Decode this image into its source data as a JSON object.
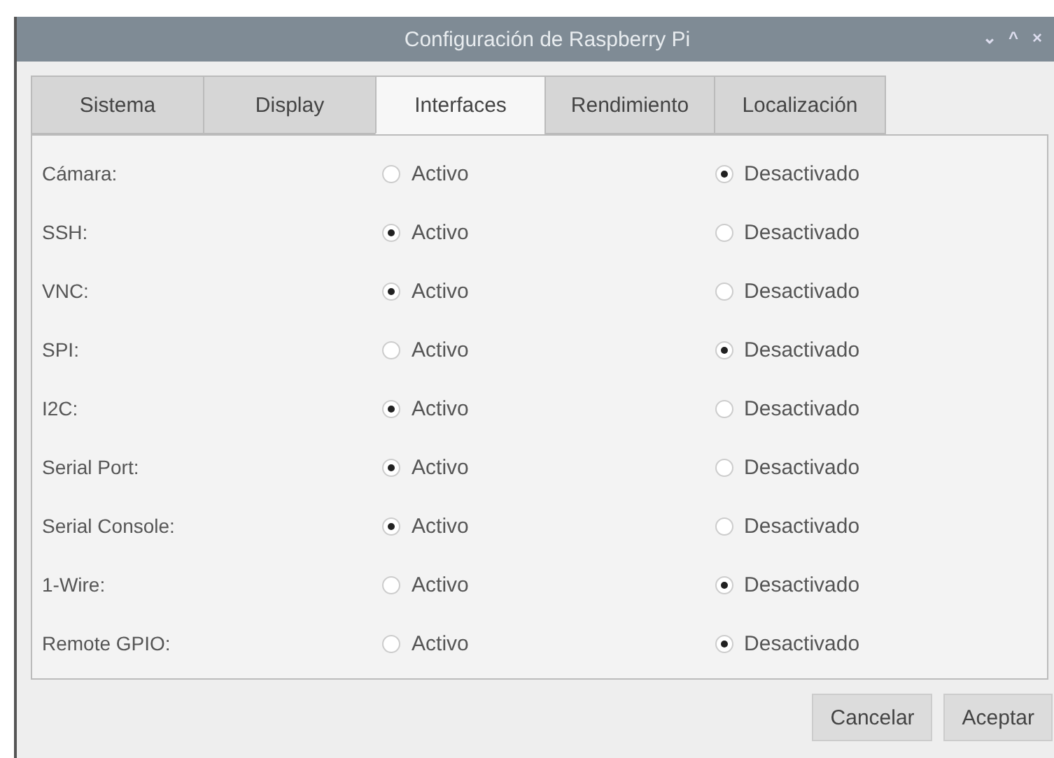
{
  "window": {
    "title": "Configuración de Raspberry Pi",
    "controls": [
      "⌄",
      "^",
      "×"
    ]
  },
  "tabs": [
    {
      "label": "Sistema",
      "selected": false
    },
    {
      "label": "Display",
      "selected": false
    },
    {
      "label": "Interfaces",
      "selected": true
    },
    {
      "label": "Rendimiento",
      "selected": false
    },
    {
      "label": "Localización",
      "selected": false
    }
  ],
  "settings": [
    {
      "label": "Cámara:",
      "options": [
        {
          "label": "Activo",
          "selected": false
        },
        {
          "label": "Desactivado",
          "selected": true
        }
      ]
    },
    {
      "label": "SSH:",
      "options": [
        {
          "label": "Activo",
          "selected": true
        },
        {
          "label": "Desactivado",
          "selected": false
        }
      ]
    },
    {
      "label": "VNC:",
      "options": [
        {
          "label": "Activo",
          "selected": true
        },
        {
          "label": "Desactivado",
          "selected": false
        }
      ]
    },
    {
      "label": "SPI:",
      "options": [
        {
          "label": "Activo",
          "selected": false
        },
        {
          "label": "Desactivado",
          "selected": true
        }
      ]
    },
    {
      "label": "I2C:",
      "options": [
        {
          "label": "Activo",
          "selected": true
        },
        {
          "label": "Desactivado",
          "selected": false
        }
      ]
    },
    {
      "label": "Serial Port:",
      "options": [
        {
          "label": "Activo",
          "selected": true
        },
        {
          "label": "Desactivado",
          "selected": false
        }
      ]
    },
    {
      "label": "Serial Console:",
      "options": [
        {
          "label": "Activo",
          "selected": true
        },
        {
          "label": "Desactivado",
          "selected": false
        }
      ]
    },
    {
      "label": "1-Wire:",
      "options": [
        {
          "label": "Activo",
          "selected": false
        },
        {
          "label": "Desactivado",
          "selected": true
        }
      ]
    },
    {
      "label": "Remote GPIO:",
      "options": [
        {
          "label": "Activo",
          "selected": false
        },
        {
          "label": "Desactivado",
          "selected": true
        }
      ]
    }
  ],
  "buttons": [
    "Cancelar",
    "Aceptar"
  ]
}
